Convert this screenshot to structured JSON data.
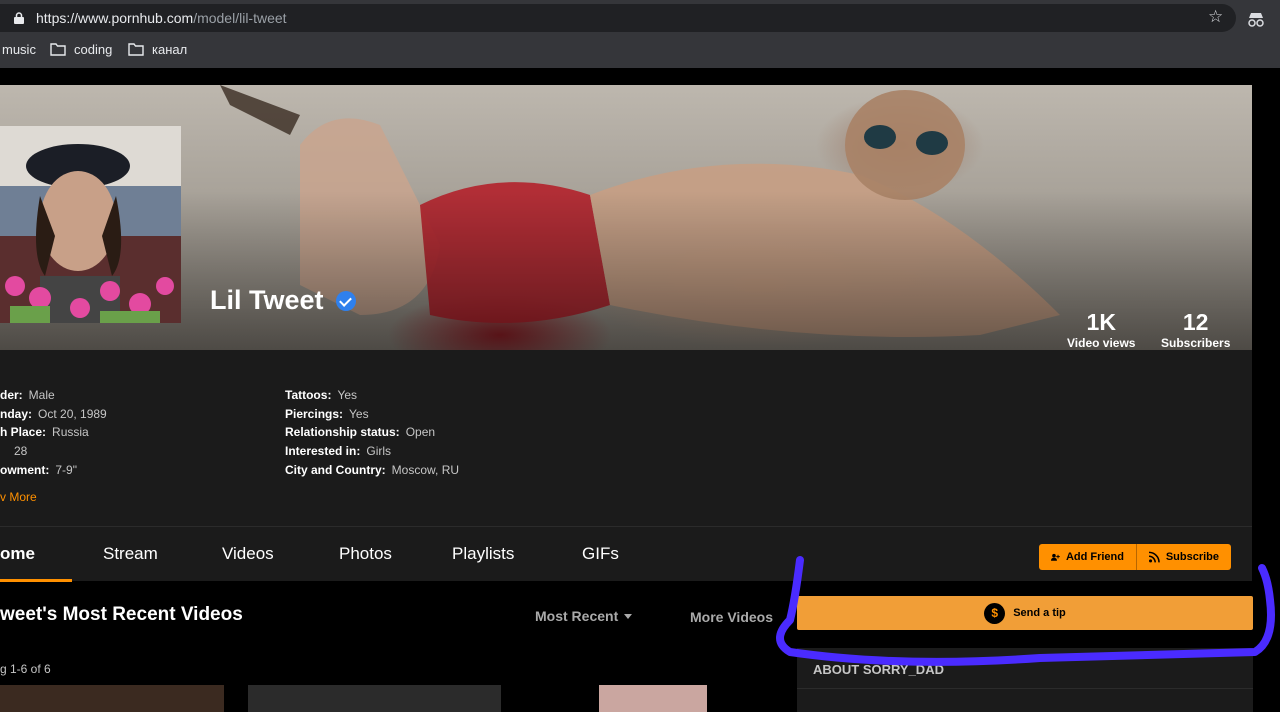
{
  "browser": {
    "url_host": "https://www.pornhub.com",
    "url_path": "/model/lil-tweet",
    "bookmarks": [
      "music",
      "coding",
      "канал"
    ]
  },
  "profile": {
    "name": "Lil Tweet",
    "video_views": "1K",
    "video_views_label": "Video views",
    "subscribers": "12",
    "subscribers_label": "Subscribers"
  },
  "details": {
    "left": [
      {
        "key": "der:",
        "value": "Male"
      },
      {
        "key": "nday:",
        "value": "Oct 20, 1989"
      },
      {
        "key": "h Place:",
        "value": "Russia"
      },
      {
        "key": "",
        "value": "28"
      },
      {
        "key": "owment:",
        "value": "7-9\""
      }
    ],
    "right": [
      {
        "key": "Tattoos:",
        "value": "Yes"
      },
      {
        "key": "Piercings:",
        "value": "Yes"
      },
      {
        "key": "Relationship status:",
        "value": "Open"
      },
      {
        "key": "Interested in:",
        "value": "Girls"
      },
      {
        "key": "City and Country:",
        "value": "Moscow, RU"
      }
    ],
    "show_more": "v More"
  },
  "tabs": [
    "ome",
    "Stream",
    "Videos",
    "Photos",
    "Playlists",
    "GIFs"
  ],
  "actions": {
    "add_friend": "Add Friend",
    "subscribe": "Subscribe"
  },
  "main": {
    "section_title": "weet's Most Recent Videos",
    "sort": "Most Recent",
    "more_videos": "More Videos",
    "showing": "g 1-6 of 6"
  },
  "sidebar": {
    "send_tip": "Send a tip",
    "dollar": "$",
    "about_title": "ABOUT SORRY_DAD"
  },
  "colors": {
    "accent": "#ff9000",
    "annotation": "#4a2bff",
    "panel": "#1b1b1b"
  }
}
